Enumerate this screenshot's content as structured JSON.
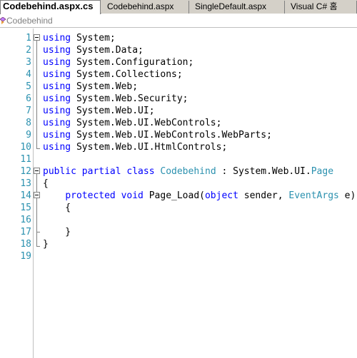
{
  "tabs": [
    {
      "label": "Codebehind.aspx.cs",
      "active": true
    },
    {
      "label": "Codebehind.aspx",
      "active": false
    },
    {
      "label": "SingleDefault.aspx",
      "active": false
    },
    {
      "label": "Visual C# 홈",
      "active": false
    }
  ],
  "navbar": {
    "class_name": "Codebehind",
    "icon": "class-icon"
  },
  "colors": {
    "keyword": "#0000ff",
    "type": "#2b91af",
    "line_number": "#2b91af",
    "text": "#000000"
  },
  "code_lines": [
    {
      "n": "1",
      "tokens": [
        [
          "kw",
          "using"
        ],
        [
          "tx",
          " System;"
        ]
      ]
    },
    {
      "n": "2",
      "tokens": [
        [
          "kw",
          "using"
        ],
        [
          "tx",
          " System.Data;"
        ]
      ]
    },
    {
      "n": "3",
      "tokens": [
        [
          "kw",
          "using"
        ],
        [
          "tx",
          " System.Configuration;"
        ]
      ]
    },
    {
      "n": "4",
      "tokens": [
        [
          "kw",
          "using"
        ],
        [
          "tx",
          " System.Collections;"
        ]
      ]
    },
    {
      "n": "5",
      "tokens": [
        [
          "kw",
          "using"
        ],
        [
          "tx",
          " System.Web;"
        ]
      ]
    },
    {
      "n": "6",
      "tokens": [
        [
          "kw",
          "using"
        ],
        [
          "tx",
          " System.Web.Security;"
        ]
      ]
    },
    {
      "n": "7",
      "tokens": [
        [
          "kw",
          "using"
        ],
        [
          "tx",
          " System.Web.UI;"
        ]
      ]
    },
    {
      "n": "8",
      "tokens": [
        [
          "kw",
          "using"
        ],
        [
          "tx",
          " System.Web.UI.WebControls;"
        ]
      ]
    },
    {
      "n": "9",
      "tokens": [
        [
          "kw",
          "using"
        ],
        [
          "tx",
          " System.Web.UI.WebControls.WebParts;"
        ]
      ]
    },
    {
      "n": "10",
      "tokens": [
        [
          "kw",
          "using"
        ],
        [
          "tx",
          " System.Web.UI.HtmlControls;"
        ]
      ]
    },
    {
      "n": "11",
      "tokens": []
    },
    {
      "n": "12",
      "tokens": [
        [
          "kw",
          "public partial class"
        ],
        [
          "tx",
          " "
        ],
        [
          "ty",
          "Codebehind"
        ],
        [
          "tx",
          " : System.Web.UI."
        ],
        [
          "ty",
          "Page"
        ]
      ]
    },
    {
      "n": "13",
      "tokens": [
        [
          "tx",
          "{"
        ]
      ]
    },
    {
      "n": "14",
      "tokens": [
        [
          "tx",
          "    "
        ],
        [
          "kw",
          "protected void"
        ],
        [
          "tx",
          " Page_Load("
        ],
        [
          "kw",
          "object"
        ],
        [
          "tx",
          " sender, "
        ],
        [
          "ty",
          "EventArgs"
        ],
        [
          "tx",
          " e)"
        ]
      ]
    },
    {
      "n": "15",
      "tokens": [
        [
          "tx",
          "    {"
        ]
      ]
    },
    {
      "n": "16",
      "tokens": []
    },
    {
      "n": "17",
      "tokens": [
        [
          "tx",
          "    }"
        ]
      ]
    },
    {
      "n": "18",
      "tokens": [
        [
          "tx",
          "}"
        ]
      ]
    },
    {
      "n": "19",
      "tokens": []
    }
  ]
}
